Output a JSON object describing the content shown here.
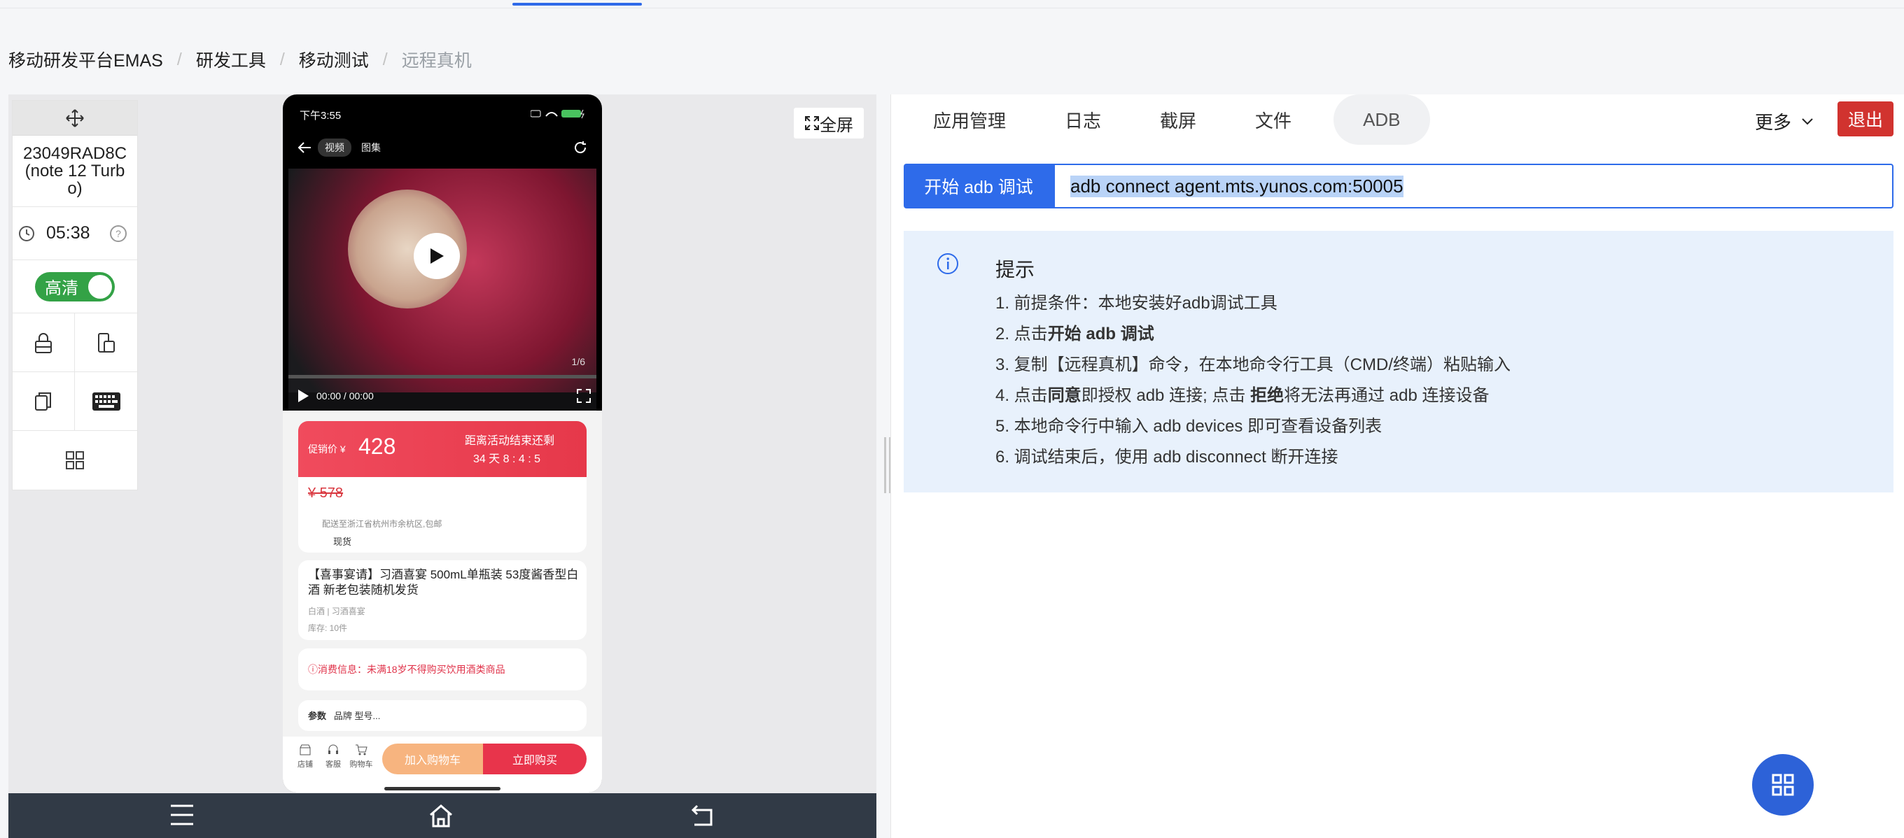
{
  "breadcrumb": {
    "items": [
      "移动研发平台EMAS",
      "研发工具",
      "移动测试"
    ],
    "current": "远程真机",
    "separator": "/"
  },
  "toolbox": {
    "device_name": "23049RAD8C(note 12 Turbo)",
    "timer": "05:38",
    "hd_label": "高清"
  },
  "fullscreen_label": "全屏",
  "phone": {
    "status_time": "下午3:55",
    "nav_tabs": [
      "视频",
      "图集"
    ],
    "video_page": "1/6",
    "video_time": "00:00 / 00:00",
    "price_label": "促销价 ¥",
    "price": "428",
    "countdown_title": "距离活动结束还剩",
    "countdown": "34 天 8 : 4 : 5",
    "original_price": "¥ 578",
    "ship_to": "配送至浙江省杭州市余杭区,包邮",
    "ship_note": "现货",
    "product_title": "【喜事宴请】习酒喜宴 500mL单瓶装 53度酱香型白酒 新老包装随机发货",
    "product_sub": "白酒 | 习酒喜宴",
    "stock": "库存: 10件",
    "warning": "ⓘ消费信息：未满18岁不得购买饮用酒类商品",
    "params_label": "参数",
    "params_value": "品牌 型号...",
    "bottom_icons": [
      "店铺",
      "客服",
      "购物车"
    ],
    "add_cart": "加入购物车",
    "buy_now": "立即购买"
  },
  "right": {
    "tabs": [
      "应用管理",
      "日志",
      "截屏",
      "文件",
      "ADB"
    ],
    "active_tab": "ADB",
    "more_label": "更多",
    "exit_label": "退出",
    "adb_start_label": "开始 adb 调试",
    "adb_command": "adb connect agent.mts.yunos.com:50005",
    "tips_title": "提示",
    "tips": {
      "t1": "1. 前提条件：本地安装好adb调试工具",
      "t2a": "2. 点击",
      "t2b": "开始 adb 调试",
      "t3": "3. 复制【远程真机】命令，在本地命令行工具（CMD/终端）粘贴输入",
      "t4a": "4. 点击",
      "t4b": "同意",
      "t4c": "即授权 adb 连接; 点击 ",
      "t4d": "拒绝",
      "t4e": "将无法再通过 adb 连接设备",
      "t5": "5. 本地命令行中输入 adb devices 即可查看设备列表",
      "t6": "6. 调试结束后，使用 adb disconnect 断开连接"
    }
  },
  "colors": {
    "accent": "#2e6bea",
    "exit": "#d1332f",
    "toggle": "#33a246",
    "tips_bg": "#e8f1fc",
    "device_nav": "#313a46"
  }
}
